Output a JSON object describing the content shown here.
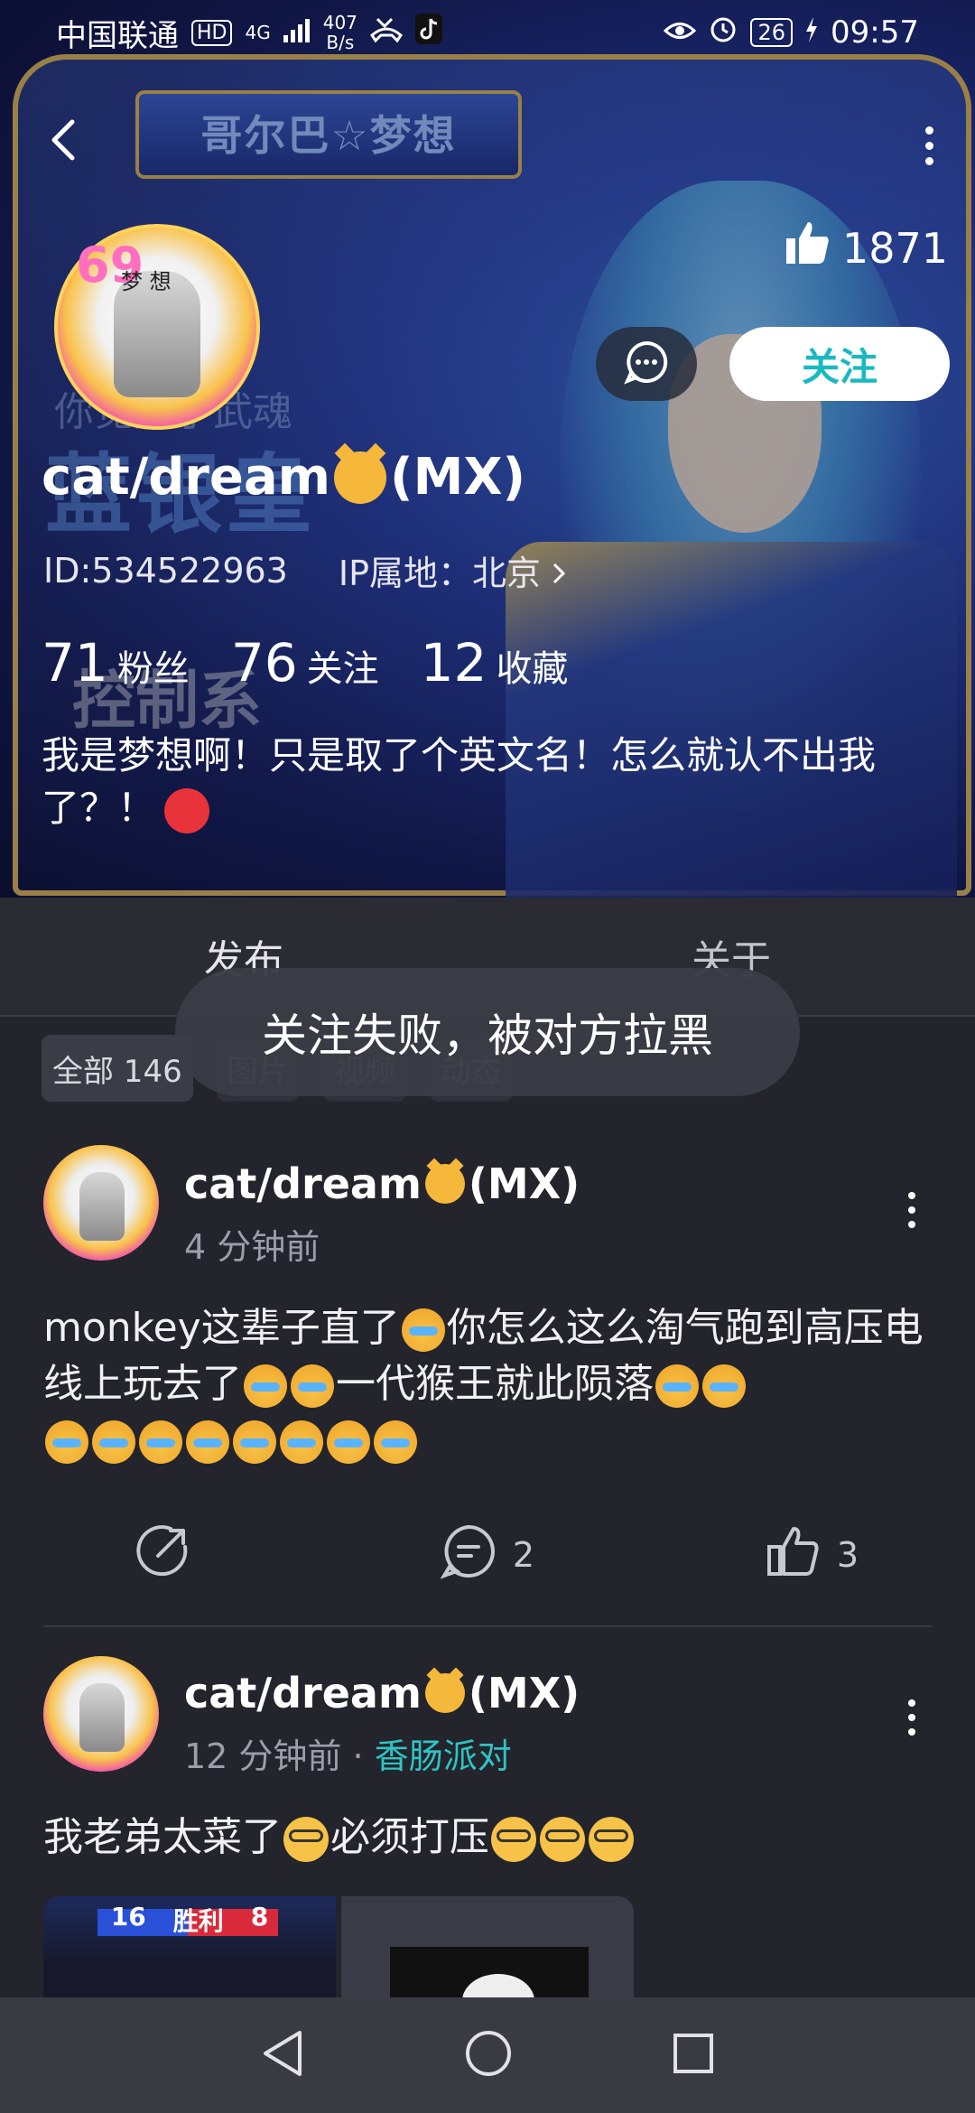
{
  "status_bar": {
    "carrier": "中国联通",
    "hd_badge": "HD",
    "network": "4G",
    "speed_value": "407",
    "speed_unit": "B/s",
    "battery": "26",
    "time": "09:57"
  },
  "profile": {
    "banner_title": "哥尔巴☆梦想",
    "banner_subtitle": "你觉醒了武魂",
    "banner_big_text": "蓝银皇",
    "banner_tag": "控制系",
    "avatar_number": "69",
    "avatar_label": "梦 想",
    "likes": "1871",
    "follow_label": "关注",
    "username_prefix": "cat/dream",
    "username_suffix": "(MX)",
    "id_text": "ID:534522963",
    "ip_text": "IP属地：北京",
    "stats": [
      {
        "num": "71",
        "label": "粉丝"
      },
      {
        "num": "76",
        "label": "关注"
      },
      {
        "num": "12",
        "label": "收藏"
      }
    ],
    "bio": "我是梦想啊！只是取了个英文名！怎么就认不出我了？！"
  },
  "tabs": [
    {
      "label": "发布"
    },
    {
      "label": "关于"
    }
  ],
  "filters": [
    {
      "label": "全部 146"
    },
    {
      "label": "图片"
    },
    {
      "label": "视频"
    },
    {
      "label": "动态"
    }
  ],
  "toast": "关注失败，被对方拉黑",
  "posts": [
    {
      "author_prefix": "cat/dream",
      "author_suffix": "(MX)",
      "time": "4 分钟前",
      "topic": "",
      "text_a": "monkey这辈子直了",
      "text_b": "你怎么这么淘气跑到高压电线上玩去了",
      "text_c": "一代猴王就此陨落",
      "comments": "2",
      "likes": "3"
    },
    {
      "author_prefix": "cat/dream",
      "author_suffix": "(MX)",
      "time": "12 分钟前",
      "sep": "·",
      "topic": "香肠派对",
      "text_a": "我老弟太菜了",
      "text_b": "必须打压",
      "thumb_left": "16",
      "thumb_right": "8",
      "thumb_title": "胜利"
    }
  ],
  "icons": {
    "back": "chevron-left-icon",
    "more": "more-vertical-icon",
    "like": "thumbs-up-icon",
    "chat": "chat-bubble-icon",
    "share": "share-icon",
    "comment": "comment-icon",
    "nav_back": "triangle-back-icon",
    "nav_home": "circle-home-icon",
    "nav_recent": "square-recent-icon"
  }
}
